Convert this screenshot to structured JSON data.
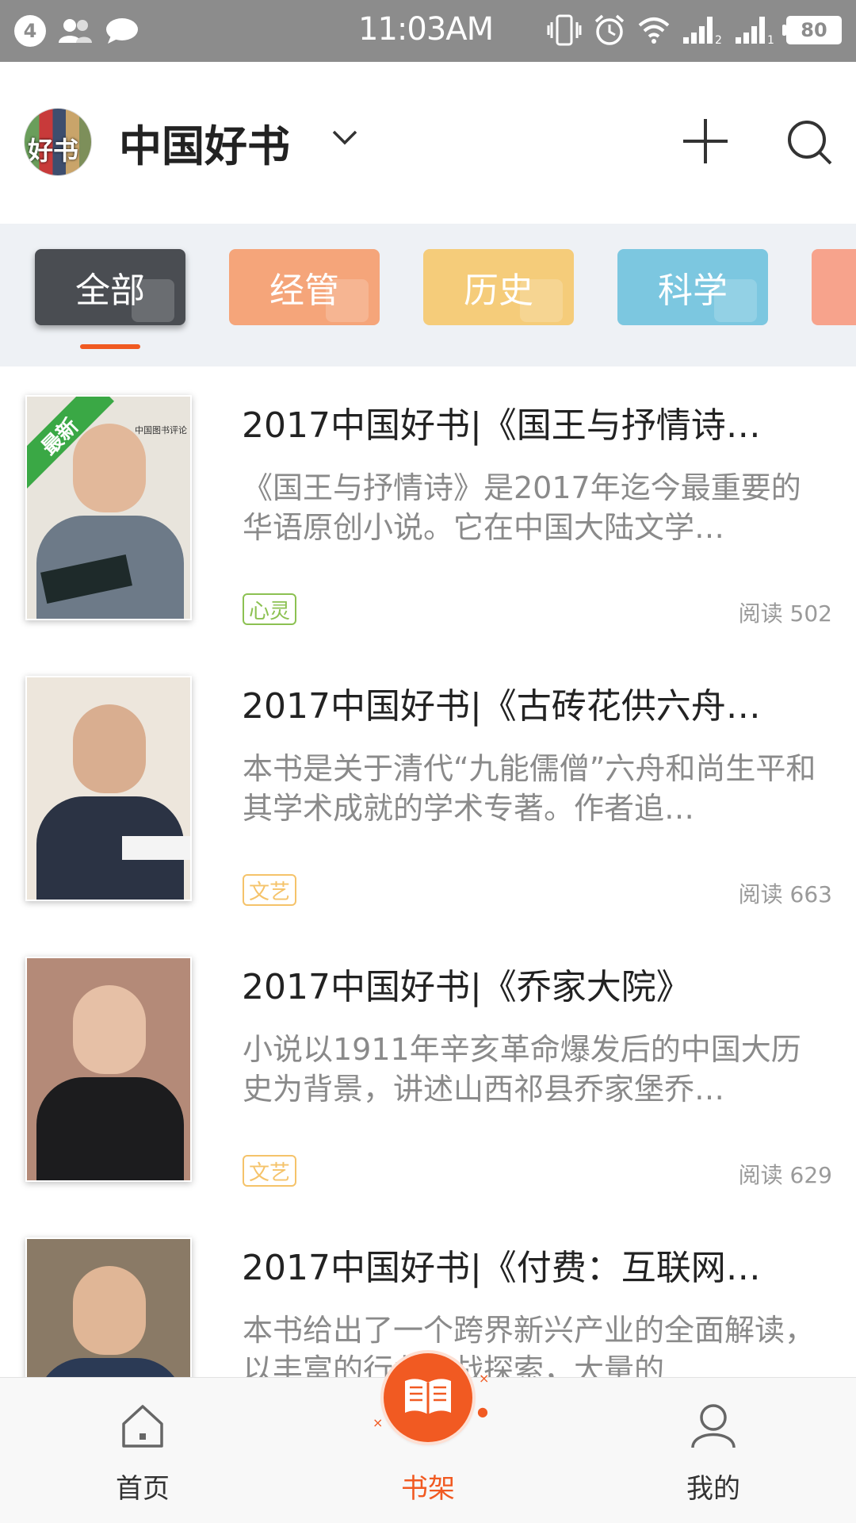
{
  "status_bar": {
    "notification_count": "4",
    "time": "11:03AM",
    "battery": "80",
    "icons": [
      "contacts-icon",
      "chat-icon",
      "vibrate-icon",
      "alarm-icon",
      "wifi-icon",
      "signal-2-icon",
      "signal-1-icon"
    ]
  },
  "header": {
    "avatar_text": "好书",
    "title": "中国好书"
  },
  "categories": [
    {
      "label": "全部",
      "color": "#4a4d52",
      "active": true
    },
    {
      "label": "经管",
      "color": "#f5a57a",
      "active": false
    },
    {
      "label": "历史",
      "color": "#f5cc7a",
      "active": false
    },
    {
      "label": "科学",
      "color": "#7cc7e0",
      "active": false
    },
    {
      "label": "",
      "color": "#f7a38c",
      "active": false
    }
  ],
  "colors": {
    "accent": "#f05a22",
    "tag_xinling": "#8cc152",
    "tag_wenyi": "#f5c36a"
  },
  "items": [
    {
      "title": "2017中国好书|《国王与抒情诗…",
      "desc": "《国王与抒情诗》是2017年迄今最重要的华语原创小说。它在中国大陆文学…",
      "tag": "心灵",
      "reads": "阅读  502",
      "ribbon": "最新",
      "thumb_logo": "中国图书评论"
    },
    {
      "title": "2017中国好书|《古砖花供六舟…",
      "desc": "本书是关于清代“九能儒僧”六舟和尚生平和其学术成就的学术专著。作者追…",
      "tag": "文艺",
      "reads": "阅读  663"
    },
    {
      "title": "2017中国好书|《乔家大院》",
      "desc": "小说以1911年辛亥革命爆发后的中国大历史为背景，讲述山西祁县乔家堡乔…",
      "tag": "文艺",
      "reads": "阅读  629"
    },
    {
      "title": "2017中国好书|《付费：互联网…",
      "desc": "本书给出了一个跨界新兴产业的全面解读，以丰富的行业实战探索，大量的"
    }
  ],
  "bottom_nav": {
    "home": "首页",
    "shelf": "书架",
    "mine": "我的"
  }
}
